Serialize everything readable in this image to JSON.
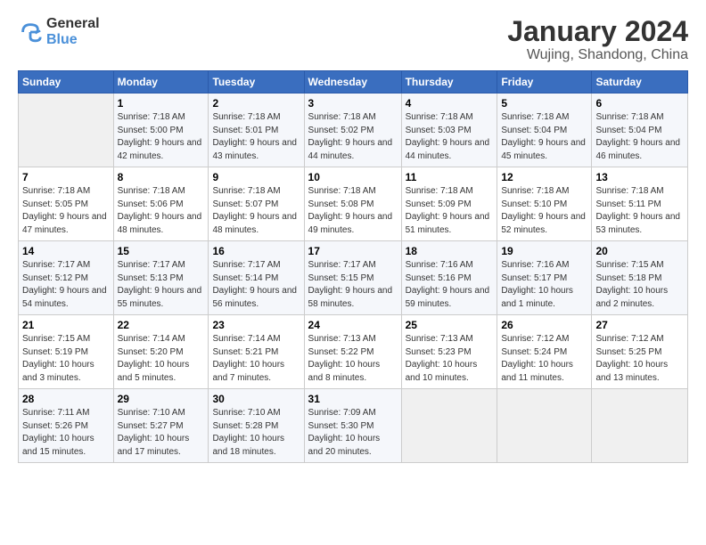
{
  "logo": {
    "general": "General",
    "blue": "Blue"
  },
  "header": {
    "month": "January 2024",
    "location": "Wujing, Shandong, China"
  },
  "weekdays": [
    "Sunday",
    "Monday",
    "Tuesday",
    "Wednesday",
    "Thursday",
    "Friday",
    "Saturday"
  ],
  "weeks": [
    [
      {
        "day": null,
        "num": null,
        "sunrise": null,
        "sunset": null,
        "daylight": null
      },
      {
        "day": 1,
        "num": "1",
        "sunrise": "Sunrise: 7:18 AM",
        "sunset": "Sunset: 5:00 PM",
        "daylight": "Daylight: 9 hours and 42 minutes."
      },
      {
        "day": 2,
        "num": "2",
        "sunrise": "Sunrise: 7:18 AM",
        "sunset": "Sunset: 5:01 PM",
        "daylight": "Daylight: 9 hours and 43 minutes."
      },
      {
        "day": 3,
        "num": "3",
        "sunrise": "Sunrise: 7:18 AM",
        "sunset": "Sunset: 5:02 PM",
        "daylight": "Daylight: 9 hours and 44 minutes."
      },
      {
        "day": 4,
        "num": "4",
        "sunrise": "Sunrise: 7:18 AM",
        "sunset": "Sunset: 5:03 PM",
        "daylight": "Daylight: 9 hours and 44 minutes."
      },
      {
        "day": 5,
        "num": "5",
        "sunrise": "Sunrise: 7:18 AM",
        "sunset": "Sunset: 5:04 PM",
        "daylight": "Daylight: 9 hours and 45 minutes."
      },
      {
        "day": 6,
        "num": "6",
        "sunrise": "Sunrise: 7:18 AM",
        "sunset": "Sunset: 5:04 PM",
        "daylight": "Daylight: 9 hours and 46 minutes."
      }
    ],
    [
      {
        "day": 7,
        "num": "7",
        "sunrise": "Sunrise: 7:18 AM",
        "sunset": "Sunset: 5:05 PM",
        "daylight": "Daylight: 9 hours and 47 minutes."
      },
      {
        "day": 8,
        "num": "8",
        "sunrise": "Sunrise: 7:18 AM",
        "sunset": "Sunset: 5:06 PM",
        "daylight": "Daylight: 9 hours and 48 minutes."
      },
      {
        "day": 9,
        "num": "9",
        "sunrise": "Sunrise: 7:18 AM",
        "sunset": "Sunset: 5:07 PM",
        "daylight": "Daylight: 9 hours and 48 minutes."
      },
      {
        "day": 10,
        "num": "10",
        "sunrise": "Sunrise: 7:18 AM",
        "sunset": "Sunset: 5:08 PM",
        "daylight": "Daylight: 9 hours and 49 minutes."
      },
      {
        "day": 11,
        "num": "11",
        "sunrise": "Sunrise: 7:18 AM",
        "sunset": "Sunset: 5:09 PM",
        "daylight": "Daylight: 9 hours and 51 minutes."
      },
      {
        "day": 12,
        "num": "12",
        "sunrise": "Sunrise: 7:18 AM",
        "sunset": "Sunset: 5:10 PM",
        "daylight": "Daylight: 9 hours and 52 minutes."
      },
      {
        "day": 13,
        "num": "13",
        "sunrise": "Sunrise: 7:18 AM",
        "sunset": "Sunset: 5:11 PM",
        "daylight": "Daylight: 9 hours and 53 minutes."
      }
    ],
    [
      {
        "day": 14,
        "num": "14",
        "sunrise": "Sunrise: 7:17 AM",
        "sunset": "Sunset: 5:12 PM",
        "daylight": "Daylight: 9 hours and 54 minutes."
      },
      {
        "day": 15,
        "num": "15",
        "sunrise": "Sunrise: 7:17 AM",
        "sunset": "Sunset: 5:13 PM",
        "daylight": "Daylight: 9 hours and 55 minutes."
      },
      {
        "day": 16,
        "num": "16",
        "sunrise": "Sunrise: 7:17 AM",
        "sunset": "Sunset: 5:14 PM",
        "daylight": "Daylight: 9 hours and 56 minutes."
      },
      {
        "day": 17,
        "num": "17",
        "sunrise": "Sunrise: 7:17 AM",
        "sunset": "Sunset: 5:15 PM",
        "daylight": "Daylight: 9 hours and 58 minutes."
      },
      {
        "day": 18,
        "num": "18",
        "sunrise": "Sunrise: 7:16 AM",
        "sunset": "Sunset: 5:16 PM",
        "daylight": "Daylight: 9 hours and 59 minutes."
      },
      {
        "day": 19,
        "num": "19",
        "sunrise": "Sunrise: 7:16 AM",
        "sunset": "Sunset: 5:17 PM",
        "daylight": "Daylight: 10 hours and 1 minute."
      },
      {
        "day": 20,
        "num": "20",
        "sunrise": "Sunrise: 7:15 AM",
        "sunset": "Sunset: 5:18 PM",
        "daylight": "Daylight: 10 hours and 2 minutes."
      }
    ],
    [
      {
        "day": 21,
        "num": "21",
        "sunrise": "Sunrise: 7:15 AM",
        "sunset": "Sunset: 5:19 PM",
        "daylight": "Daylight: 10 hours and 3 minutes."
      },
      {
        "day": 22,
        "num": "22",
        "sunrise": "Sunrise: 7:14 AM",
        "sunset": "Sunset: 5:20 PM",
        "daylight": "Daylight: 10 hours and 5 minutes."
      },
      {
        "day": 23,
        "num": "23",
        "sunrise": "Sunrise: 7:14 AM",
        "sunset": "Sunset: 5:21 PM",
        "daylight": "Daylight: 10 hours and 7 minutes."
      },
      {
        "day": 24,
        "num": "24",
        "sunrise": "Sunrise: 7:13 AM",
        "sunset": "Sunset: 5:22 PM",
        "daylight": "Daylight: 10 hours and 8 minutes."
      },
      {
        "day": 25,
        "num": "25",
        "sunrise": "Sunrise: 7:13 AM",
        "sunset": "Sunset: 5:23 PM",
        "daylight": "Daylight: 10 hours and 10 minutes."
      },
      {
        "day": 26,
        "num": "26",
        "sunrise": "Sunrise: 7:12 AM",
        "sunset": "Sunset: 5:24 PM",
        "daylight": "Daylight: 10 hours and 11 minutes."
      },
      {
        "day": 27,
        "num": "27",
        "sunrise": "Sunrise: 7:12 AM",
        "sunset": "Sunset: 5:25 PM",
        "daylight": "Daylight: 10 hours and 13 minutes."
      }
    ],
    [
      {
        "day": 28,
        "num": "28",
        "sunrise": "Sunrise: 7:11 AM",
        "sunset": "Sunset: 5:26 PM",
        "daylight": "Daylight: 10 hours and 15 minutes."
      },
      {
        "day": 29,
        "num": "29",
        "sunrise": "Sunrise: 7:10 AM",
        "sunset": "Sunset: 5:27 PM",
        "daylight": "Daylight: 10 hours and 17 minutes."
      },
      {
        "day": 30,
        "num": "30",
        "sunrise": "Sunrise: 7:10 AM",
        "sunset": "Sunset: 5:28 PM",
        "daylight": "Daylight: 10 hours and 18 minutes."
      },
      {
        "day": 31,
        "num": "31",
        "sunrise": "Sunrise: 7:09 AM",
        "sunset": "Sunset: 5:30 PM",
        "daylight": "Daylight: 10 hours and 20 minutes."
      },
      {
        "day": null,
        "num": null,
        "sunrise": null,
        "sunset": null,
        "daylight": null
      },
      {
        "day": null,
        "num": null,
        "sunrise": null,
        "sunset": null,
        "daylight": null
      },
      {
        "day": null,
        "num": null,
        "sunrise": null,
        "sunset": null,
        "daylight": null
      }
    ]
  ]
}
